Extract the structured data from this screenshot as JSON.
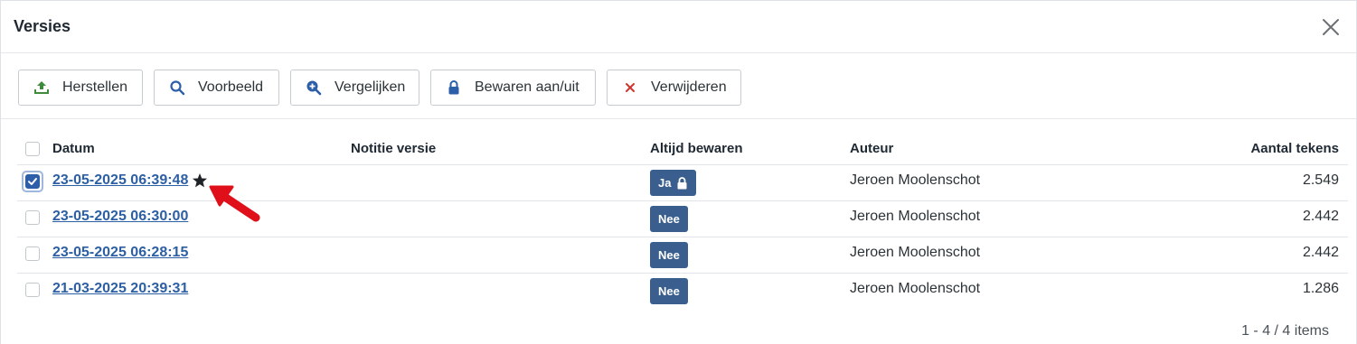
{
  "dialog": {
    "title": "Versies",
    "close_icon": "close-icon"
  },
  "toolbar": {
    "restore_label": "Herstellen",
    "preview_label": "Voorbeeld",
    "compare_label": "Vergelijken",
    "keep_label": "Bewaren aan/uit",
    "delete_label": "Verwijderen"
  },
  "table": {
    "headers": {
      "date": "Datum",
      "note": "Notitie versie",
      "always_keep": "Altijd bewaren",
      "author": "Auteur",
      "char_count": "Aantal tekens"
    },
    "rows": [
      {
        "date": "23-05-2025 06:39:48",
        "note": "",
        "keep": "Ja",
        "keep_locked": true,
        "author": "Jeroen Moolenschot",
        "chars": "2.549",
        "selected": true,
        "starred": true
      },
      {
        "date": "23-05-2025 06:30:00",
        "note": "",
        "keep": "Nee",
        "keep_locked": false,
        "author": "Jeroen Moolenschot",
        "chars": "2.442",
        "selected": false,
        "starred": false
      },
      {
        "date": "23-05-2025 06:28:15",
        "note": "",
        "keep": "Nee",
        "keep_locked": false,
        "author": "Jeroen Moolenschot",
        "chars": "2.442",
        "selected": false,
        "starred": false
      },
      {
        "date": "21-03-2025 20:39:31",
        "note": "",
        "keep": "Nee",
        "keep_locked": false,
        "author": "Jeroen Moolenschot",
        "chars": "1.286",
        "selected": false,
        "starred": false
      }
    ]
  },
  "pager": {
    "text": "1 - 4 / 4 items"
  },
  "colors": {
    "accent": "#2d5ea8",
    "badge": "#3a5f8e",
    "link": "#2c5fa3",
    "delete": "#d0342c",
    "restore": "#3f8a3b",
    "annotation_arrow": "#e0101a"
  }
}
